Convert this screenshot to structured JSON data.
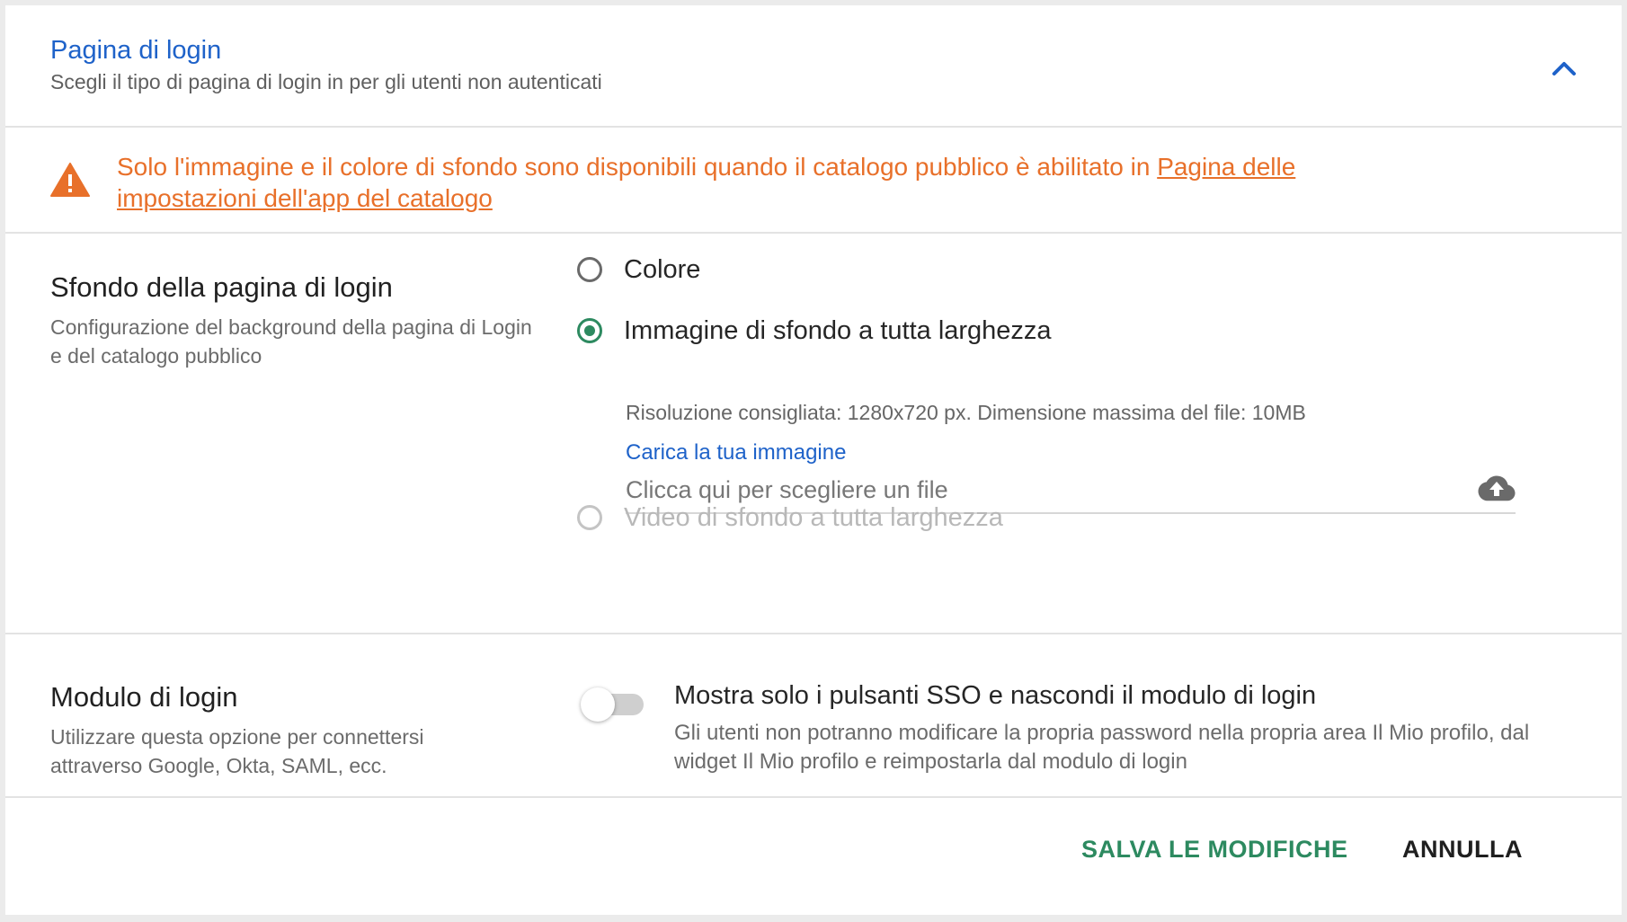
{
  "header": {
    "title": "Pagina di login",
    "subtitle": "Scegli il tipo di pagina di login in per gli utenti non autenticati",
    "collapse_icon": "chevron-up-icon",
    "accent_color": "#1e62c9"
  },
  "warning": {
    "icon": "warning-triangle-icon",
    "text": "Solo l'immagine e il colore di sfondo sono disponibili quando il catalogo pubblico è abilitato in ",
    "link_text": "Pagina delle impostazioni dell'app del catalogo",
    "color": "#e8702a"
  },
  "background_section": {
    "title": "Sfondo della pagina di login",
    "description": "Configurazione del background della pagina di Login e del catalogo pubblico",
    "options": [
      {
        "label": "Colore",
        "checked": false,
        "disabled": false
      },
      {
        "label": "Immagine di sfondo a tutta larghezza",
        "checked": true,
        "disabled": false
      },
      {
        "label": "Video di sfondo a tutta larghezza",
        "checked": false,
        "disabled": true
      }
    ],
    "hint": "Risoluzione consigliata: 1280x720 px. Dimensione massima del file: 10MB",
    "upload_label": "Carica la tua immagine",
    "upload_placeholder": "Clicca qui per scegliere un file",
    "upload_icon": "cloud-upload-icon"
  },
  "login_form_section": {
    "title": "Modulo di login",
    "description": "Utilizzare questa opzione per connettersi attraverso Google, Okta, SAML, ecc.",
    "toggle_on": false,
    "toggle_title": "Mostra solo i pulsanti SSO e nascondi il modulo di login",
    "toggle_description": "Gli utenti non potranno modificare la propria password nella propria area Il Mio profilo, dal widget Il Mio profilo e reimpostarla dal modulo di login"
  },
  "footer": {
    "save_label": "SALVA LE MODIFICHE",
    "cancel_label": "ANNULLA",
    "save_color": "#2d8a60"
  }
}
